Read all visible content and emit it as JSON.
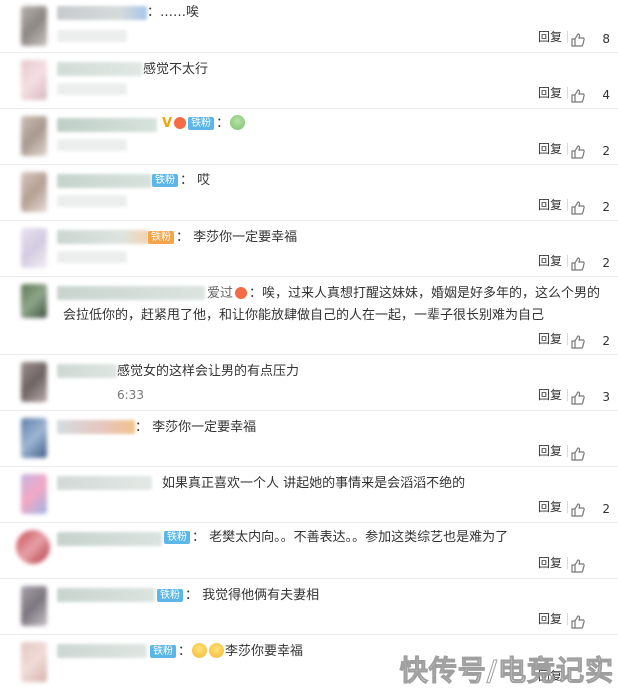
{
  "reply_label": "回复",
  "watermark": "快传号/电竞记实",
  "badge_text": "铁粉",
  "comments": [
    {
      "text": "：……唉",
      "likes": "8"
    },
    {
      "text": "感觉不太行",
      "likes": "4"
    },
    {
      "text": "：",
      "likes": "2"
    },
    {
      "text": "：  哎",
      "likes": "2"
    },
    {
      "text": "：  李莎你一定要幸福",
      "likes": "2"
    },
    {
      "text": "爱过",
      "text_b": "：唉，过来人真想打醒这妹妹，婚姻是好多年的，这么个男的",
      "text2": "会拉低你的，赶紧甩了他，和让你能放肆做自己的人在一起，一辈子很长别难为自己",
      "likes": "2"
    },
    {
      "text": "感觉女的这样会让男的有点压力",
      "time": "6:33",
      "likes": "3"
    },
    {
      "text": "：  李莎你一定要幸福",
      "likes": ""
    },
    {
      "text": "如果真正喜欢一个人 讲起她的事情来是会滔滔不绝的",
      "likes": "2"
    },
    {
      "text": "：  老樊太内向。。不善表达。。参加这类综艺也是难为了",
      "likes": ""
    },
    {
      "text": "：  我觉得他俩有夫妻相",
      "likes": ""
    },
    {
      "text": "：",
      "text_b": "李莎你要幸福",
      "likes": ""
    }
  ]
}
